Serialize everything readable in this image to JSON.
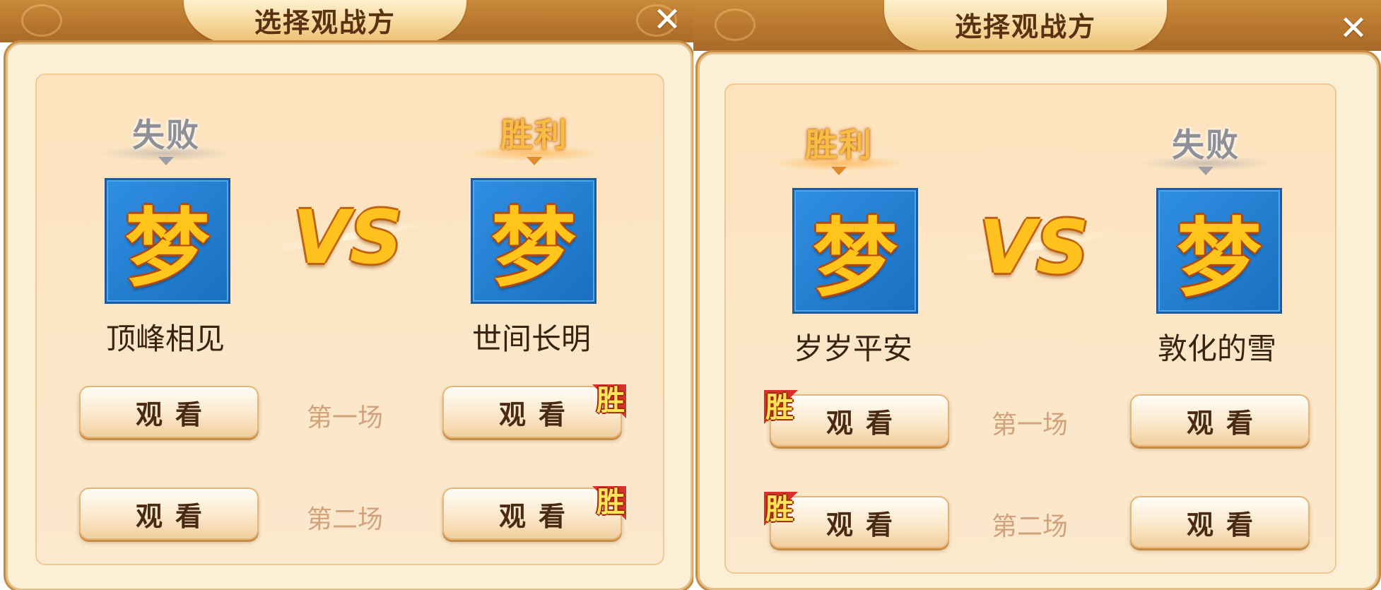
{
  "panels": [
    {
      "title": "选择观战方",
      "close_icon": "close-icon",
      "vs_text": "VS",
      "left_player": {
        "name": "顶峰相见",
        "result": "失败",
        "avatar_char": "梦"
      },
      "right_player": {
        "name": "世间长明",
        "result": "胜利",
        "avatar_char": "梦"
      },
      "rounds": [
        {
          "label": "第一场",
          "left_button": "观看",
          "right_button": "观看",
          "winner": "right",
          "win_badge": "胜"
        },
        {
          "label": "第二场",
          "left_button": "观看",
          "right_button": "观看",
          "winner": "right",
          "win_badge": "胜"
        }
      ]
    },
    {
      "title": "选择观战方",
      "close_icon": "close-icon",
      "vs_text": "VS",
      "left_player": {
        "name": "岁岁平安",
        "result": "胜利",
        "avatar_char": "梦"
      },
      "right_player": {
        "name": "敦化的雪",
        "result": "失败",
        "avatar_char": "梦"
      },
      "rounds": [
        {
          "label": "第一场",
          "left_button": "观看",
          "right_button": "观看",
          "winner": "left",
          "win_badge": "胜"
        },
        {
          "label": "第二场",
          "left_button": "观看",
          "right_button": "观看",
          "winner": "left",
          "win_badge": "胜"
        }
      ]
    }
  ],
  "colors": {
    "header_brown": "#b8772d",
    "title_tab": "#f6d699",
    "panel_bg": "#fbefd6",
    "avatar_blue": "#1a6fc0",
    "avatar_glyph_gold": "#ffc51a",
    "win_gold": "#f8bd45",
    "lose_gray": "#8f8f96",
    "win_badge_red": "#d8302a"
  }
}
